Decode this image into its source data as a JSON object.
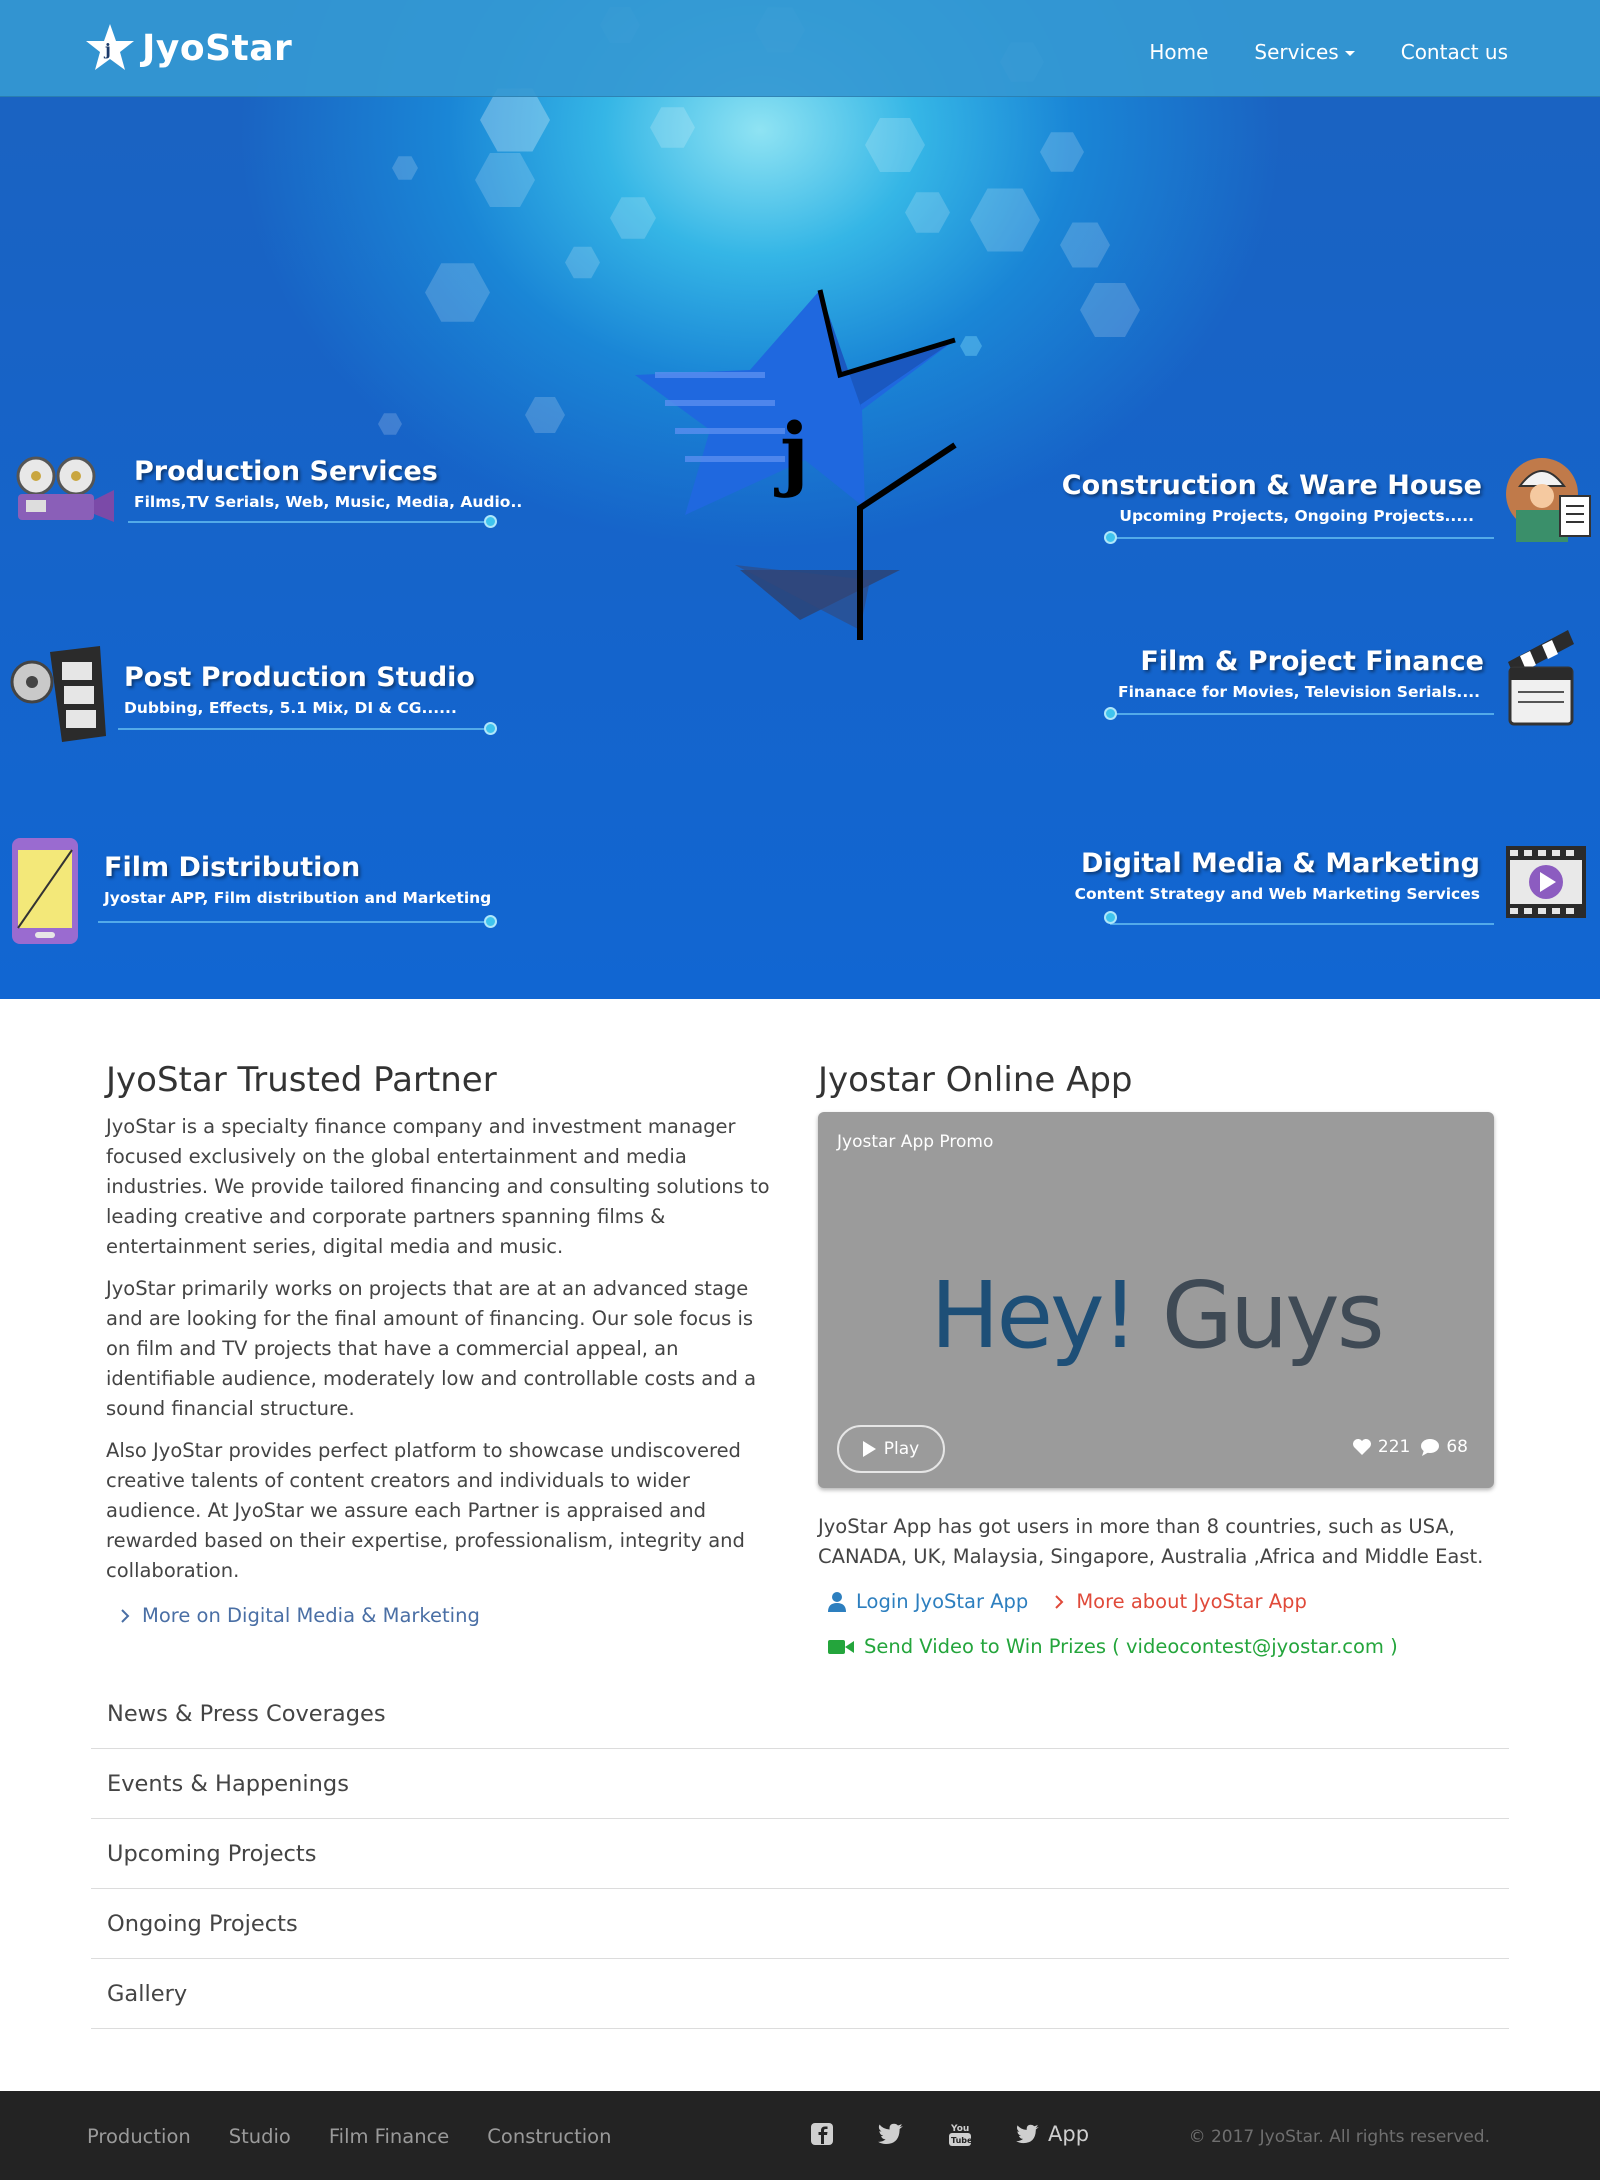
{
  "brand": {
    "name": "JyoStar",
    "logo_icon": "star-j-logo-icon"
  },
  "nav": {
    "home": "Home",
    "services": "Services",
    "contact": "Contact us"
  },
  "hero": {
    "services_left": [
      {
        "title": "Production Services",
        "subtitle": "Films,TV Serials, Web, Music, Media, Audio..",
        "icon": "film-projector-icon"
      },
      {
        "title": "Post Production Studio",
        "subtitle": "Dubbing, Effects, 5.1 Mix, DI & CG......",
        "icon": "film-reel-icon"
      },
      {
        "title": "Film Distribution",
        "subtitle": "Jyostar  APP, Film distribution and Marketing",
        "icon": "mobile-phone-icon"
      }
    ],
    "services_right": [
      {
        "title": "Construction & Ware House",
        "subtitle": "Upcoming Projects, Ongoing Projects.....",
        "icon": "engineer-icon"
      },
      {
        "title": "Film & Project Finance",
        "subtitle": "Finanace for Movies, Television Serials....",
        "icon": "clapperboard-icon"
      },
      {
        "title": "Digital Media & Marketing",
        "subtitle": "Content Strategy and Web Marketing Services",
        "icon": "video-player-icon"
      }
    ],
    "center_logo_letter": "j"
  },
  "partner": {
    "title": "JyoStar Trusted Partner",
    "paragraphs": [
      "JyoStar is a specialty finance company and investment manager focused exclusively on the global entertainment and media industries. We provide tailored financing and consulting solutions to leading creative and corporate partners spanning films & entertainment series, digital media and music.",
      "JyoStar primarily works on projects that are at an advanced stage and are looking for the final amount of financing. Our sole focus is on film and TV projects that have a commercial appeal, an identifiable audience, moderately low and controllable costs and a sound financial structure.",
      "Also JyoStar provides perfect platform to showcase undiscovered creative talents of content creators and individuals to wider audience. At JyoStar we assure each Partner is appraised and rewarded based on their expertise, professionalism, integrity and collaboration."
    ],
    "more_link": "More on Digital Media & Marketing"
  },
  "app": {
    "title": "Jyostar Online App",
    "video": {
      "title": "Jyostar App Promo",
      "text_part1": "Hey!",
      "text_part2": "Guys",
      "play_label": "Play",
      "likes": "221",
      "comments": "68"
    },
    "description": "JyoStar App has got users in more than 8 countries, such as USA, CANADA, UK, Malaysia, Singapore, Australia ,Africa and Middle East.",
    "login_link": "Login JyoStar App",
    "more_link": "More about JyoStar App",
    "contest_link": "Send Video to Win Prizes ( videocontest@jyostar.com )"
  },
  "accordion": [
    "News & Press Coverages",
    "Events & Happenings",
    "Upcoming Projects",
    "Ongoing Projects",
    "Gallery"
  ],
  "footer": {
    "links": [
      "Production",
      "Studio",
      "Film Finance",
      "Construction"
    ],
    "app_label": "App",
    "copyright": "© 2017 JyoStar. All rights reserved."
  },
  "colors": {
    "hero_blue": "#1166d2",
    "nav_bg": "#3498d2",
    "link_blue": "#2d7fbf",
    "link_red": "#e04a3a",
    "link_green": "#24a53c",
    "footer_bg": "#232323"
  }
}
